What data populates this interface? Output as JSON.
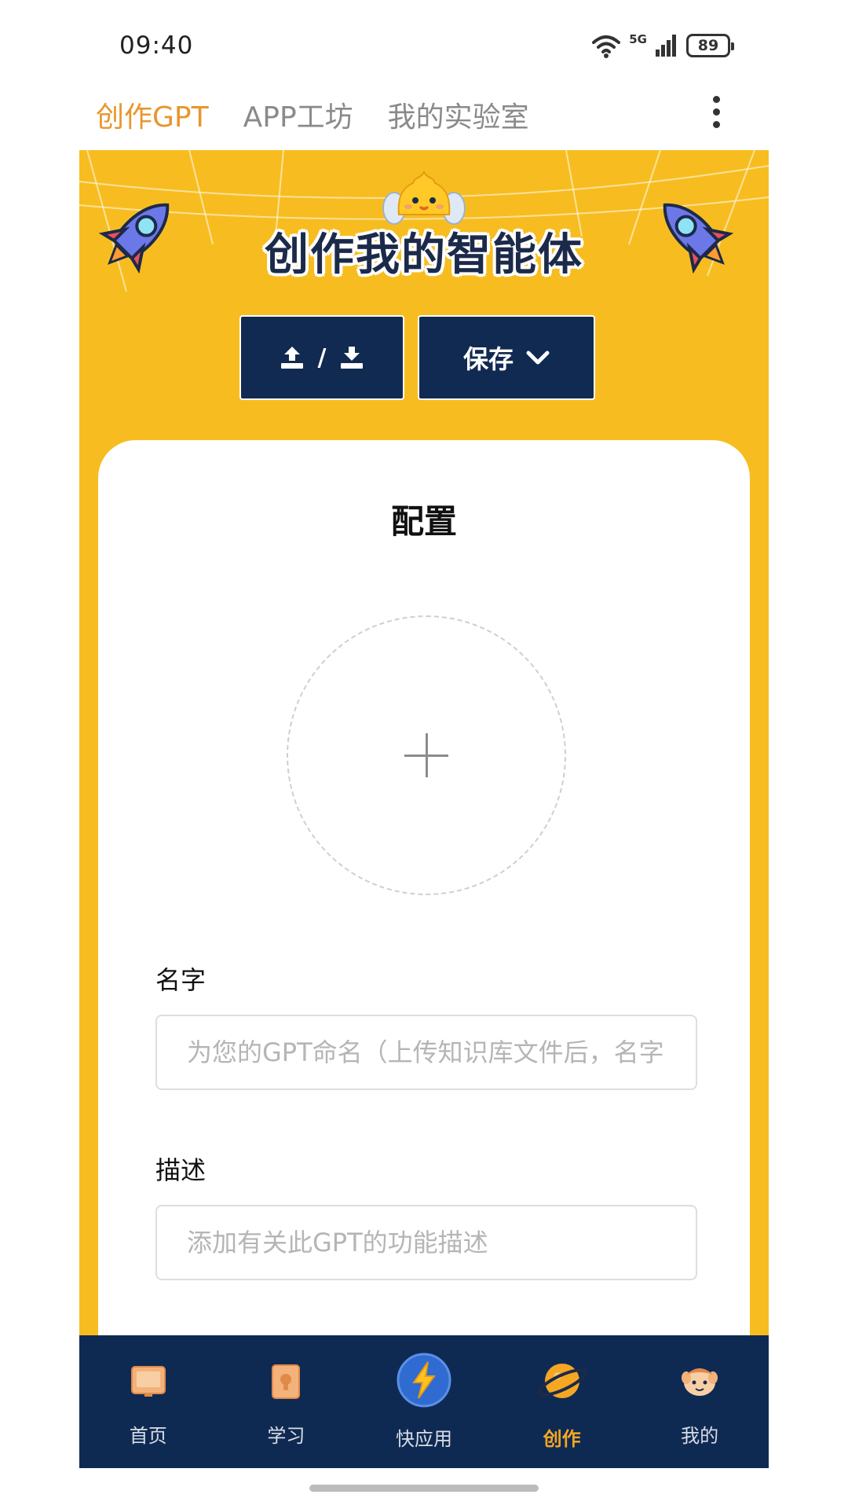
{
  "status_bar": {
    "time": "09:40",
    "signal_label": "5G",
    "battery": "89",
    "icons": [
      "wifi-icon",
      "signal-icon",
      "battery-icon"
    ]
  },
  "top_tabs": {
    "items": [
      {
        "label": "创作GPT",
        "active": true
      },
      {
        "label": "APP工坊",
        "active": false
      },
      {
        "label": "我的实验室",
        "active": false
      }
    ],
    "accent_color": "#E8962C"
  },
  "banner": {
    "title": "创作我的智能体",
    "background_color": "#F7BD20"
  },
  "actions": {
    "slash": "/",
    "save_label": "保存",
    "icons": [
      "upload-icon",
      "download-icon",
      "chevron-down-icon"
    ]
  },
  "config": {
    "title": "配置",
    "name_label": "名字",
    "name_placeholder": "为您的GPT命名（上传知识库文件后，名字",
    "description_label": "描述",
    "description_placeholder": "添加有关此GPT的功能描述"
  },
  "bottom_nav": {
    "items": [
      {
        "label": "首页",
        "icon": "home-icon",
        "active": false
      },
      {
        "label": "学习",
        "icon": "book-icon",
        "active": false
      },
      {
        "label": "快应用",
        "icon": "lightning-icon",
        "active": false
      },
      {
        "label": "创作",
        "icon": "planet-icon",
        "active": true
      },
      {
        "label": "我的",
        "icon": "profile-icon",
        "active": false
      }
    ],
    "background_color": "#0F2A52",
    "active_color": "#F5A623"
  }
}
